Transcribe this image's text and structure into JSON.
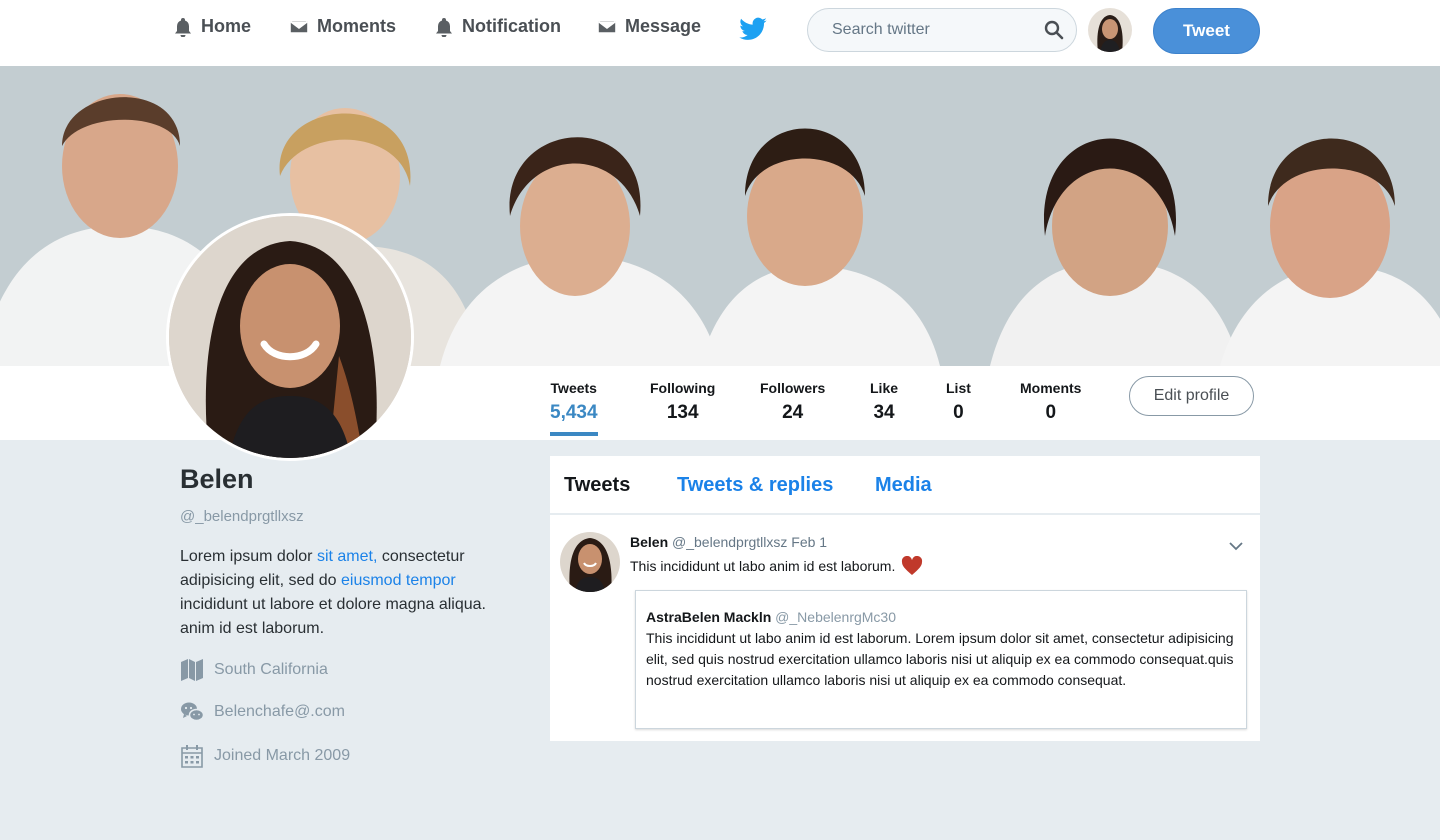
{
  "nav": {
    "items": [
      {
        "label": "Home",
        "icon": "bell-icon"
      },
      {
        "label": "Moments",
        "icon": "envelope-icon"
      },
      {
        "label": "Notification",
        "icon": "bell-icon"
      },
      {
        "label": "Message",
        "icon": "envelope-icon"
      }
    ],
    "search_placeholder": "Search twitter",
    "tweet_button": "Tweet",
    "accent": "#4a90d9"
  },
  "stats": [
    {
      "label": "Tweets",
      "value": "5,434"
    },
    {
      "label": "Following",
      "value": "134"
    },
    {
      "label": "Followers",
      "value": "24"
    },
    {
      "label": "Like",
      "value": "34"
    },
    {
      "label": "List",
      "value": "0"
    },
    {
      "label": "Moments",
      "value": "0"
    }
  ],
  "edit_profile": "Edit profile",
  "profile": {
    "name": "Belen",
    "handle": "@_belendprgtllxsz",
    "bio": {
      "p1": "Lorem ipsum dolor ",
      "link1": "sit amet,",
      "p2": " consectetur adipisicing elit, sed do ",
      "link2": "eiusmod tempor",
      "p3": " incididunt ut labore et dolore magna aliqua. anim id est laborum."
    },
    "location": "South California",
    "contact": "Belenchafe@.com",
    "joined": "Joined March 2009"
  },
  "tabs": [
    "Tweets",
    "Tweets & replies",
    "Media"
  ],
  "tweet": {
    "name": "Belen",
    "handle": "@_belendprgtllxsz",
    "date": "Feb 1",
    "text": "This incididunt ut labo anim id est laborum.",
    "quote": {
      "name": "AstraBelen Mackln",
      "handle": "@_NebelenrgMc30",
      "text": "This incididunt ut labo anim id est laborum. Lorem ipsum dolor sit amet, consectetur adipisicing elit, sed quis nostrud exercitation ullamco laboris nisi ut aliquip ex ea commodo consequat.quis nostrud exercitation ullamco laboris nisi ut aliquip ex ea commodo consequat."
    }
  },
  "colors": {
    "link": "#1b82e8",
    "active_stat": "#3b88c3",
    "heart": "#c0392b",
    "background": "#e6ecf0"
  }
}
